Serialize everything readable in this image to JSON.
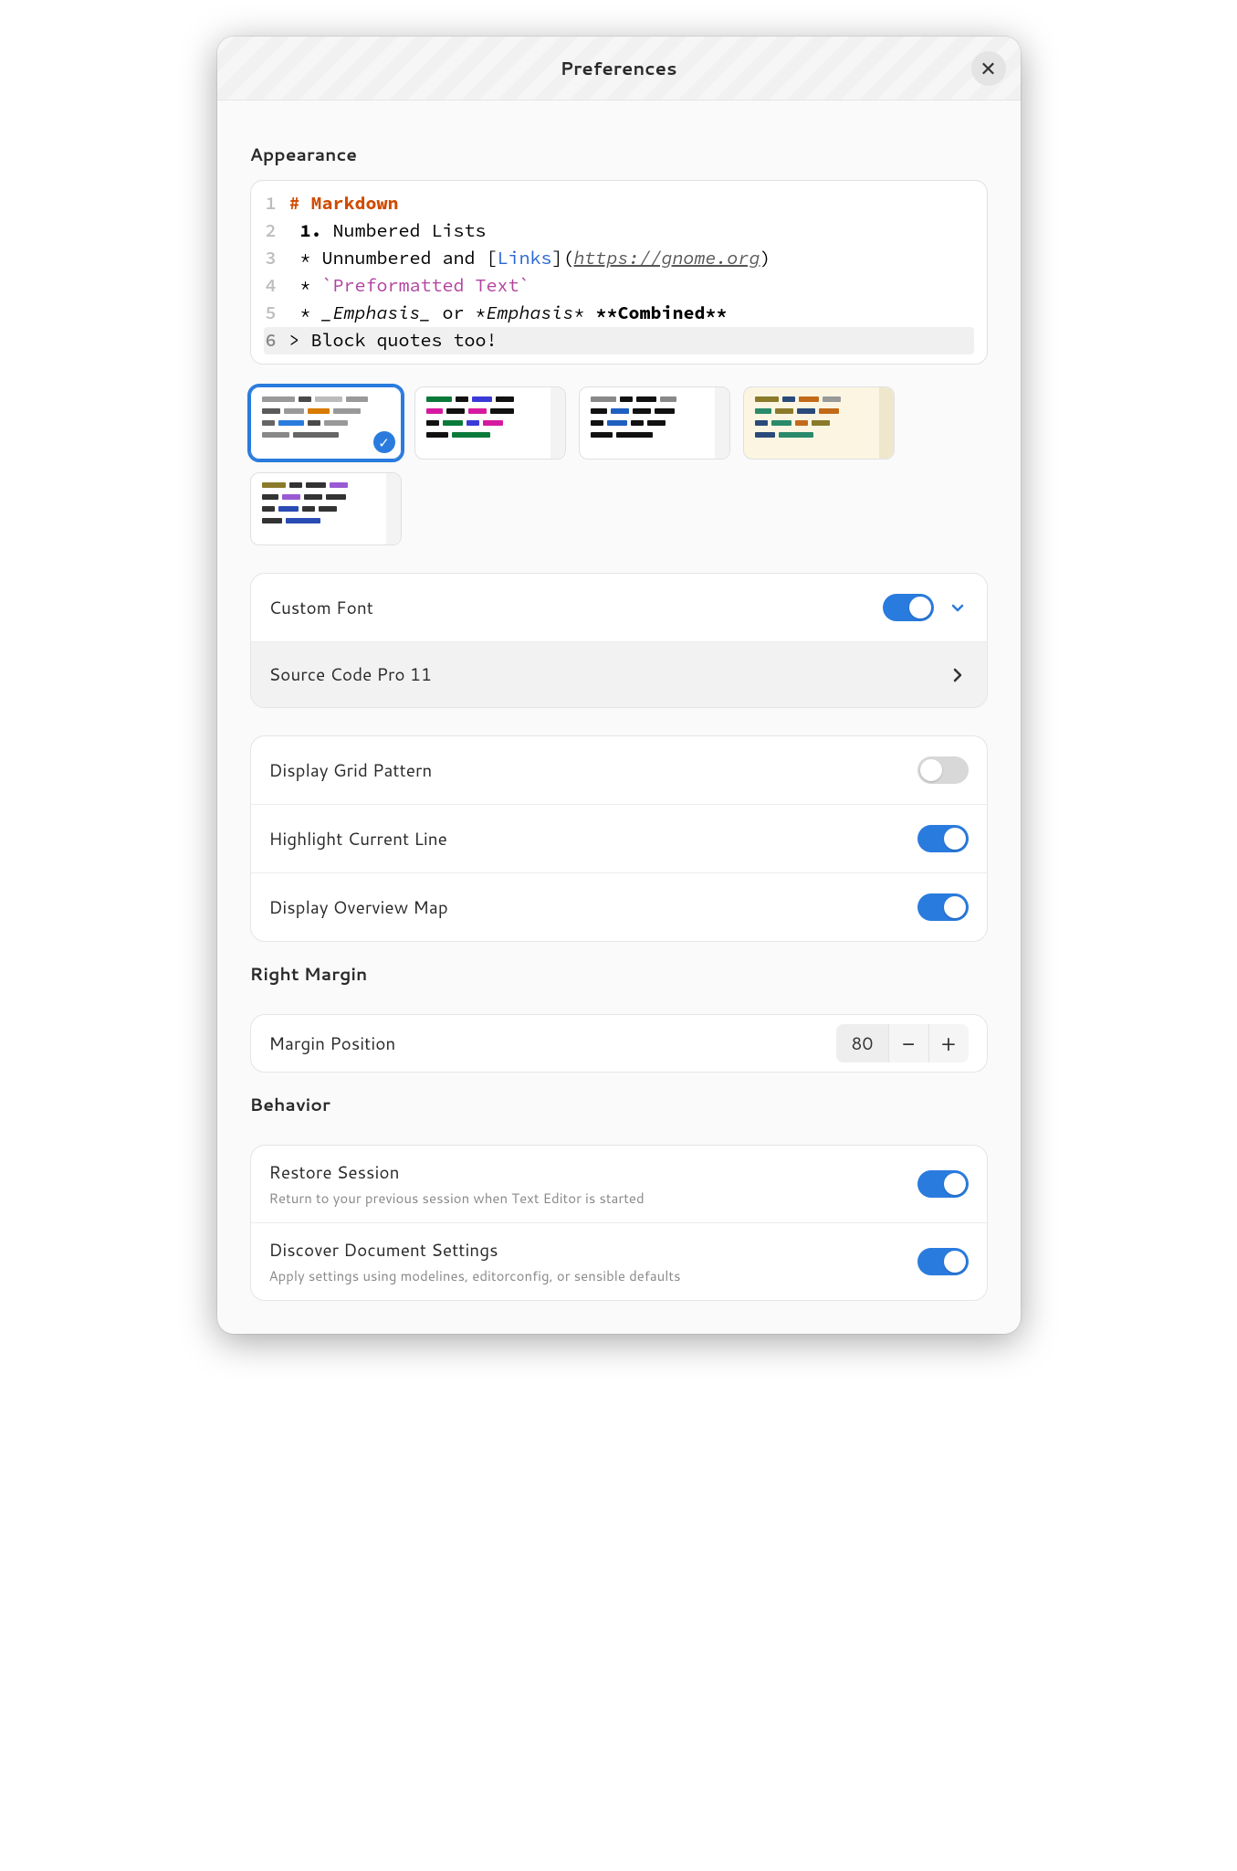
{
  "header": {
    "title": "Preferences"
  },
  "appearance": {
    "title": "Appearance",
    "preview_lines": [
      {
        "n": "1",
        "type": "h1",
        "text": "# Markdown"
      },
      {
        "n": "2",
        "type": "ol",
        "num": "1.",
        "text": " Numbered Lists"
      },
      {
        "n": "3",
        "type": "li",
        "pre": " * Unnumbered and [",
        "link": "Links",
        "mid": "](",
        "url": "https://gnome.org",
        "post": ")"
      },
      {
        "n": "4",
        "type": "pre",
        "pre": " * ",
        "code": "`Preformatted Text`"
      },
      {
        "n": "5",
        "type": "em",
        "pre": " * ",
        "e1": "_Emphasis_",
        "mid": " or *",
        "e2": "Emphasis",
        "mid2": "* ",
        "b": "**Combined**"
      },
      {
        "n": "6",
        "type": "bq",
        "text": "> Block quotes too!"
      }
    ],
    "themes_selected_index": 0,
    "custom_font": {
      "label": "Custom Font",
      "enabled": true,
      "value": "Source Code Pro 11"
    },
    "display_grid": {
      "label": "Display Grid Pattern",
      "enabled": false
    },
    "highlight_line": {
      "label": "Highlight Current Line",
      "enabled": true
    },
    "overview_map": {
      "label": "Display Overview Map",
      "enabled": true
    }
  },
  "right_margin": {
    "title": "Right Margin",
    "position_label": "Margin Position",
    "position_value": "80"
  },
  "behavior": {
    "title": "Behavior",
    "restore": {
      "label": "Restore Session",
      "desc": "Return to your previous session when Text Editor is started",
      "enabled": true
    },
    "discover": {
      "label": "Discover Document Settings",
      "desc": "Apply settings using modelines, editorconfig, or sensible defaults",
      "enabled": true
    }
  }
}
